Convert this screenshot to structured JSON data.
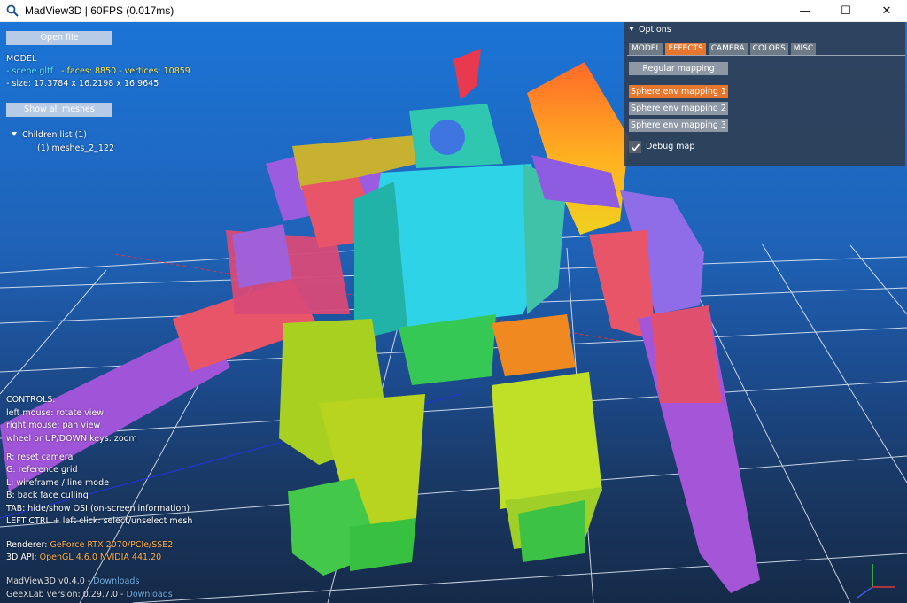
{
  "window": {
    "title": "MadView3D | 60FPS (0.017ms)",
    "minimize": "—",
    "maximize": "☐",
    "close": "✕"
  },
  "osd": {
    "open_file": "Open file",
    "model_heading": "MODEL",
    "file_line": "- scene.gltf",
    "stats_line": "- faces: 8850 - vertices: 10859",
    "size_line": "- size:  17.3784 x 16.2198 x 16.9645",
    "show_all_meshes": "Show all meshes",
    "children_list": "Children list (1)",
    "child_item": "(1) meshes_2_122",
    "controls": {
      "heading": "CONTROLS:",
      "left_mouse": "left mouse: rotate view",
      "right_mouse": "right mouse: pan view",
      "wheel": "wheel or UP/DOWN keys: zoom",
      "r": "R: reset camera",
      "g": "G: reference grid",
      "l": "L: wireframe / line mode",
      "b": "B: back face culling",
      "tab": "TAB: hide/show OSI (on-screen information)",
      "ctrl": "LEFT CTRL + left click: select/unselect mesh"
    },
    "renderer_label": "Renderer:",
    "renderer_value": "GeForce RTX 2070/PCIe/SSE2",
    "api_label": "3D API:",
    "api_value": "OpenGL 4.6.0 NVIDIA 441.20",
    "version_label": "MadView3D v0.4.0",
    "downloads": "Downloads",
    "geexlab_label": "GeeXLab version: 0.29.7.0"
  },
  "options": {
    "header": "Options",
    "tabs": [
      "MODEL",
      "EFFECTS",
      "CAMERA",
      "COLORS",
      "MISC"
    ],
    "active_tab": "EFFECTS",
    "buttons": [
      "Regular mapping",
      "Sphere env mapping 1",
      "Sphere env mapping 2",
      "Sphere env mapping 3"
    ],
    "active_button": "Sphere env mapping 1",
    "debug_map": "Debug map",
    "debug_map_checked": true
  },
  "colors": {
    "accent": "#e8772e",
    "file_color": "#58e8ff",
    "stats_color": "#ffe84a",
    "renderer_color": "#ffb14a",
    "link_color": "#7fc4ff"
  }
}
